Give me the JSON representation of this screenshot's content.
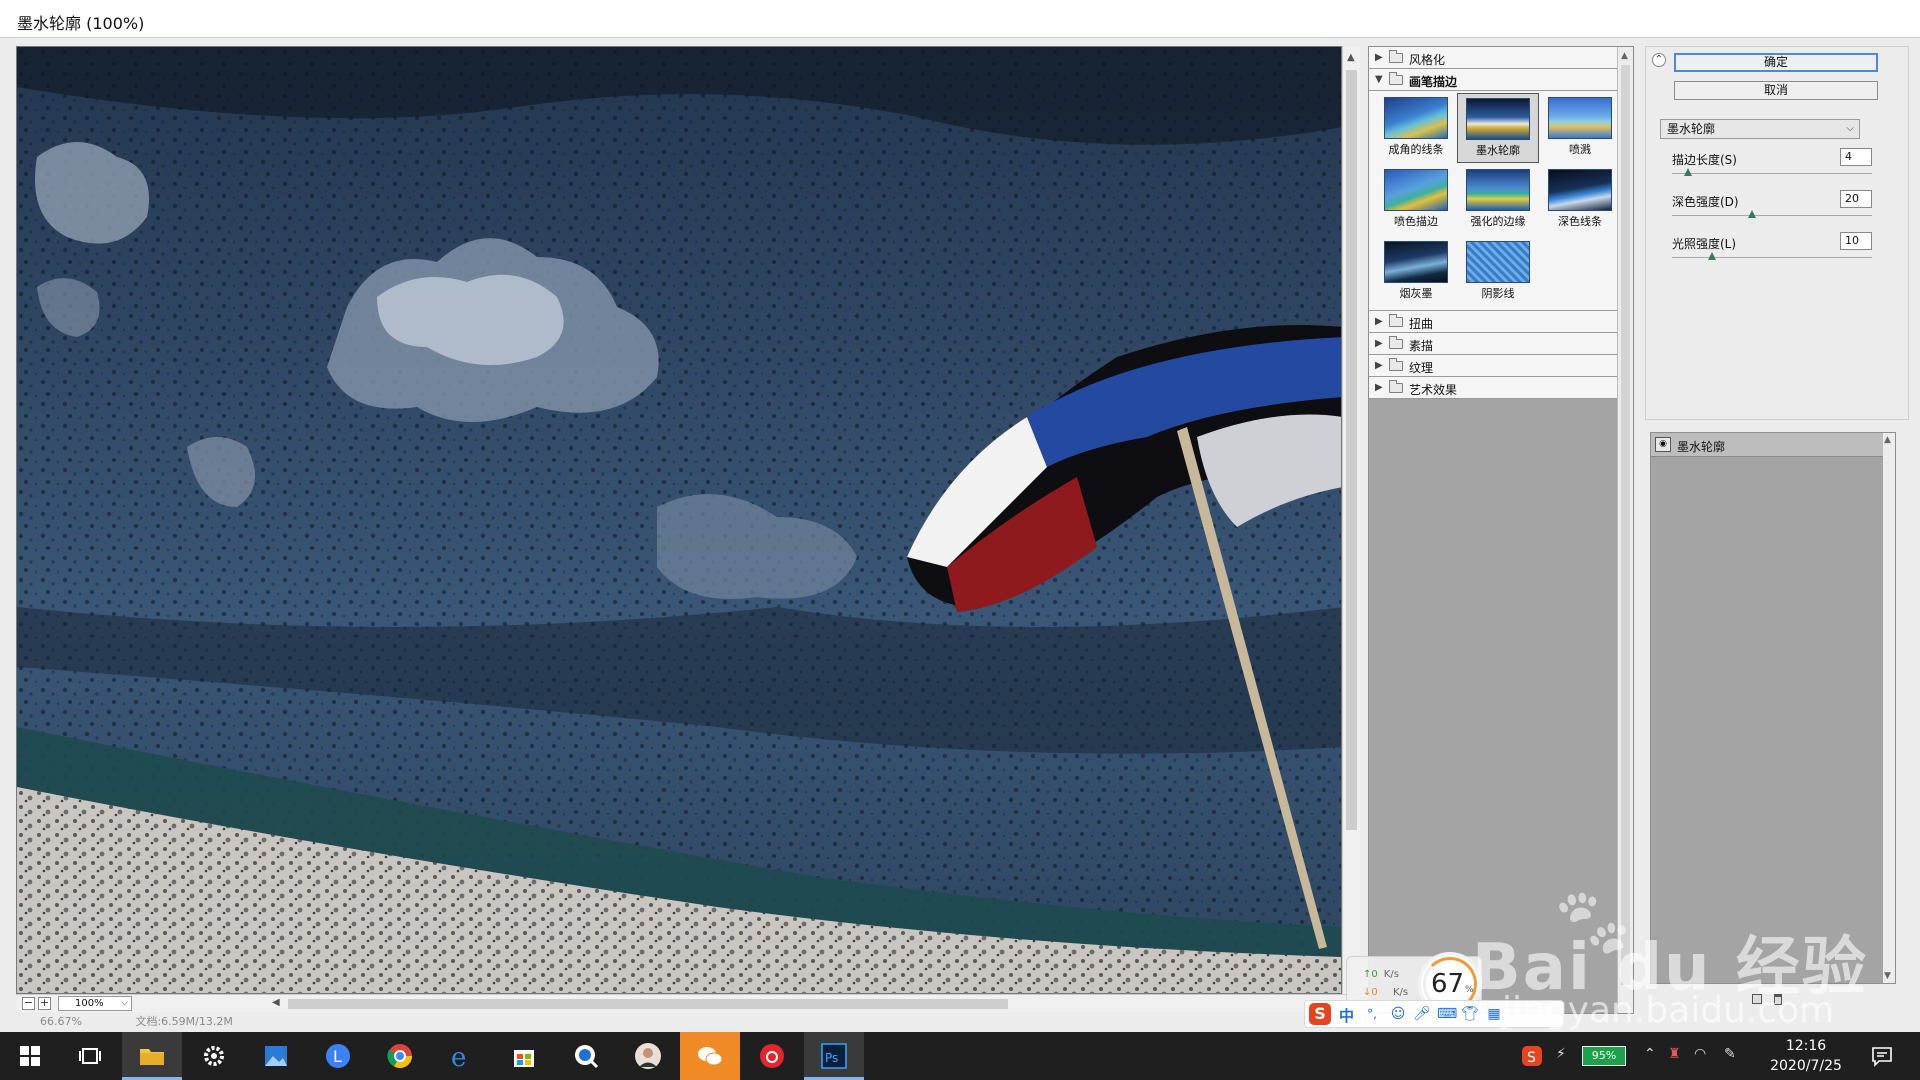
{
  "window": {
    "title": "墨水轮廓 (100%)"
  },
  "preview": {
    "zoom_value": "100%",
    "status_zoom": "66.67%",
    "doc_size": "文档:6.59M/13.2M"
  },
  "filter_gallery": {
    "categories_top": [
      {
        "label": "风格化",
        "open": false
      }
    ],
    "open_category": {
      "label": "画笔描边"
    },
    "thumbnails": [
      {
        "label": "成角的线条",
        "selected": false
      },
      {
        "label": "墨水轮廓",
        "selected": true
      },
      {
        "label": "喷溅",
        "selected": false
      },
      {
        "label": "喷色描边",
        "selected": false
      },
      {
        "label": "强化的边缘",
        "selected": false
      },
      {
        "label": "深色线条",
        "selected": false
      },
      {
        "label": "烟灰墨",
        "selected": false
      },
      {
        "label": "阴影线",
        "selected": false
      }
    ],
    "categories_bottom": [
      {
        "label": "扭曲"
      },
      {
        "label": "素描"
      },
      {
        "label": "纹理"
      },
      {
        "label": "艺术效果"
      }
    ]
  },
  "controls": {
    "ok_label": "确定",
    "cancel_label": "取消",
    "filter_select": "墨水轮廓",
    "params": [
      {
        "label": "描边长度(S)",
        "value": "4",
        "fraction": 0.08
      },
      {
        "label": "深色强度(D)",
        "value": "20",
        "fraction": 0.4
      },
      {
        "label": "光照强度(L)",
        "value": "10",
        "fraction": 0.2
      }
    ]
  },
  "layers": {
    "items": [
      {
        "name": "墨水轮廓"
      }
    ]
  },
  "net_widget": {
    "upload": "0",
    "download": "0",
    "unit": "K/s",
    "gauge_value": "67",
    "gauge_unit": "%"
  },
  "ime": {
    "logo": "S",
    "mode": "中",
    "punct": "°,"
  },
  "watermark": {
    "brand": "Bai du 经验",
    "url": "jingyan.baidu.com"
  },
  "taskbar": {
    "battery": "95%",
    "time": "12:16",
    "date": "2020/7/25",
    "apps": [
      "start",
      "task-view",
      "file-explorer",
      "settings",
      "photos",
      "lens",
      "chrome",
      "edge",
      "store",
      "search-app",
      "avatar-app",
      "wechat",
      "netease-music",
      "photoshop"
    ]
  },
  "colors": {
    "accent": "#4a8ad6",
    "panel_gray": "#a4a4a4",
    "taskbar": "#1f1f1f",
    "battery": "#1ca24b"
  }
}
